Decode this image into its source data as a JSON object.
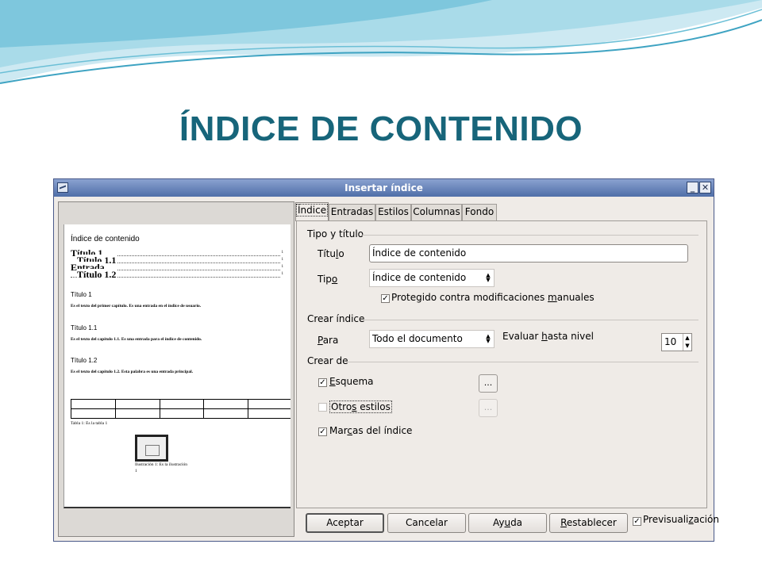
{
  "slide": {
    "title": "ÍNDICE DE CONTENIDO"
  },
  "dialog": {
    "title": "Insertar índice",
    "preview": {
      "toc_title": "Índice de contenido",
      "toc_entries": [
        {
          "label": "Título 1",
          "page": "1"
        },
        {
          "label": "Título 1.1",
          "page": "1"
        },
        {
          "label": "Entrada",
          "page": "1"
        },
        {
          "label": "Título 1.2",
          "page": "1"
        }
      ],
      "sections": [
        {
          "heading": "Título 1",
          "text": "Es el texto del primer capítulo. Es una entrada en el índice de usuario."
        },
        {
          "heading": "Título 1.1",
          "text": "Es el texto del capítulo 1.1. Es una entrada para el índice de contenido."
        },
        {
          "heading": "Título 1.2",
          "text": "Es el texto del capítulo 1.2. Esta palabra es una entrada principal."
        }
      ],
      "table_caption": "Tabla 1: Es la tabla 1",
      "illustration_caption": "Ilustración 1: Es la ilustración",
      "illustration_caption_2": "1"
    },
    "tabs": [
      "Índice",
      "Entradas",
      "Estilos",
      "Columnas",
      "Fondo"
    ],
    "active_tab": "Índice",
    "type_title": {
      "group_label": "Tipo y título",
      "title_label_pre": "Títu",
      "title_label_u": "l",
      "title_label_post": "o",
      "title_value": "Índice de contenido",
      "type_label_pre": "Tip",
      "type_label_u": "o",
      "type_label_post": "",
      "type_value": "Índice de contenido",
      "protected_label_pre": "Protegido contra modificaciones ",
      "protected_label_u": "m",
      "protected_label_post": "anuales",
      "protected_checked": true
    },
    "create_index": {
      "group_label": "Crear índice",
      "for_label_pre": "",
      "for_label_u": "P",
      "for_label_post": "ara",
      "for_value": "Todo el documento",
      "level_label_pre": "Evaluar ",
      "level_label_u": "h",
      "level_label_post": "asta nivel",
      "level_value": "10"
    },
    "create_from": {
      "group_label": "Crear de",
      "outline_label_pre": "",
      "outline_label_u": "E",
      "outline_label_post": "squema",
      "outline_checked": true,
      "outline_button": "...",
      "other_styles_label_pre": "Otro",
      "other_styles_label_u": "s",
      "other_styles_label_post": " estilos",
      "other_styles_checked": false,
      "other_styles_button": "...",
      "index_marks_label_pre": "Mar",
      "index_marks_label_u": "c",
      "index_marks_label_post": "as del índice",
      "index_marks_checked": true
    },
    "buttons": {
      "accept": "Aceptar",
      "cancel": "Cancelar",
      "help_pre": "Ay",
      "help_u": "u",
      "help_post": "da",
      "reset_pre": "",
      "reset_u": "R",
      "reset_post": "establecer"
    },
    "preview_toggle": {
      "label_pre": "Previsuali",
      "label_u": "z",
      "label_post": "ación",
      "checked": true
    },
    "check_mark": "✓",
    "colors": {
      "title_color": "#17657a",
      "titlebar": "#5a78b0"
    }
  }
}
